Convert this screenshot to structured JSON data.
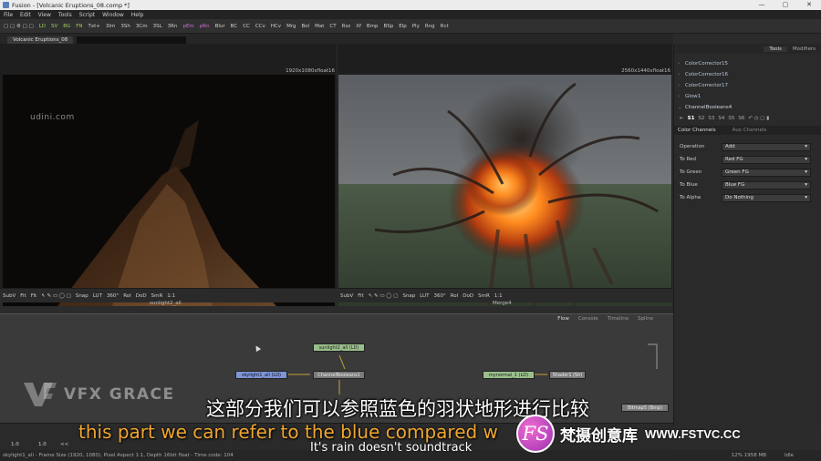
{
  "window": {
    "title": "Fusion - [Volcanic Eruptions_08.comp *]"
  },
  "menu": [
    "File",
    "Edit",
    "View",
    "Tools",
    "Script",
    "Window",
    "Help"
  ],
  "toolbar": [
    "LD",
    "SV",
    "BG",
    "FN",
    "Txt+",
    "3Im",
    "3Sh",
    "3Cm",
    "3SL",
    "3Rn",
    "pEm",
    "pRn",
    "Blur",
    "BC",
    "CC",
    "CCv",
    "HCv",
    "Mrg",
    "Bol",
    "Mat",
    "CT",
    "Rsz",
    "Xf",
    "Bmp",
    "BSp",
    "Elp",
    "Ply",
    "Rng",
    "Rct"
  ],
  "tab": {
    "label": "Volcanic Eruptions_08"
  },
  "viewer_left": {
    "resolution": "1920x1080xfloat16",
    "label": "sunlight2_all",
    "overlay_text": "udini.com"
  },
  "viewer_right": {
    "resolution": "2560x1440xfloat16",
    "label": "Merge4"
  },
  "viewer_tools": {
    "subv": "SubV",
    "fit": "Fit",
    "snap": "Snap",
    "lut": "LUT",
    "angle": "360°",
    "roi": "RoI",
    "dod": "DoD",
    "smr": "SmR",
    "ratio": "1:1"
  },
  "right_panel": {
    "tabs": [
      "Tools",
      "Modifiers"
    ],
    "tree": [
      "ColorCorrector15",
      "ColorCorrector16",
      "ColorCorrector17",
      "Glow1",
      "ChannelBooleans4"
    ],
    "slots": [
      "S1",
      "S2",
      "S3",
      "S4",
      "S5",
      "S6"
    ],
    "subtabs": [
      "Color Channels",
      "Aux Channels"
    ],
    "params": [
      {
        "label": "Operation",
        "value": "Add"
      },
      {
        "label": "To Red",
        "value": "Red   FG"
      },
      {
        "label": "To Green",
        "value": "Green FG"
      },
      {
        "label": "To Blue",
        "value": "Blue   FG"
      },
      {
        "label": "To Alpha",
        "value": "Do Nothing"
      }
    ]
  },
  "flow": {
    "tabs": [
      "Flow",
      "Console",
      "Timeline",
      "Spline"
    ],
    "nodes": [
      {
        "label": "sunlight2_all (LD)",
        "kind": "green"
      },
      {
        "label": "skylight1_all (LD)",
        "kind": "blue"
      },
      {
        "label": "ChannelBooleans1",
        "kind": "gray"
      },
      {
        "label": "mynormal_1 (LD)",
        "kind": "green"
      },
      {
        "label": "Shader1 (Sh)",
        "kind": "gray"
      },
      {
        "label": "Bitmap5 (Bmp)",
        "kind": "gray"
      }
    ]
  },
  "timeline": {
    "start": "1.0",
    "end": "1.0"
  },
  "status": {
    "text": "skylight1_all - Frame Size (1920, 1080), Pixel Aspect 1:1, Depth 16bit float - Time code: 104",
    "right": "Idle",
    "mem": "12% 1958 MB"
  },
  "overlay": {
    "brand_left": "VFX GRACE",
    "subtitle_cn": "这部分我们可以参照蓝色的羽状地形进行比较",
    "subtitle_en": "this part we can refer to the blue compared w",
    "subtitle_en2": "It's rain doesn't soundtrack",
    "brand_right_cn": "梵摄创意库",
    "brand_right_url": "WWW.FSTVC.CC",
    "brand_right_logo": "FS"
  }
}
